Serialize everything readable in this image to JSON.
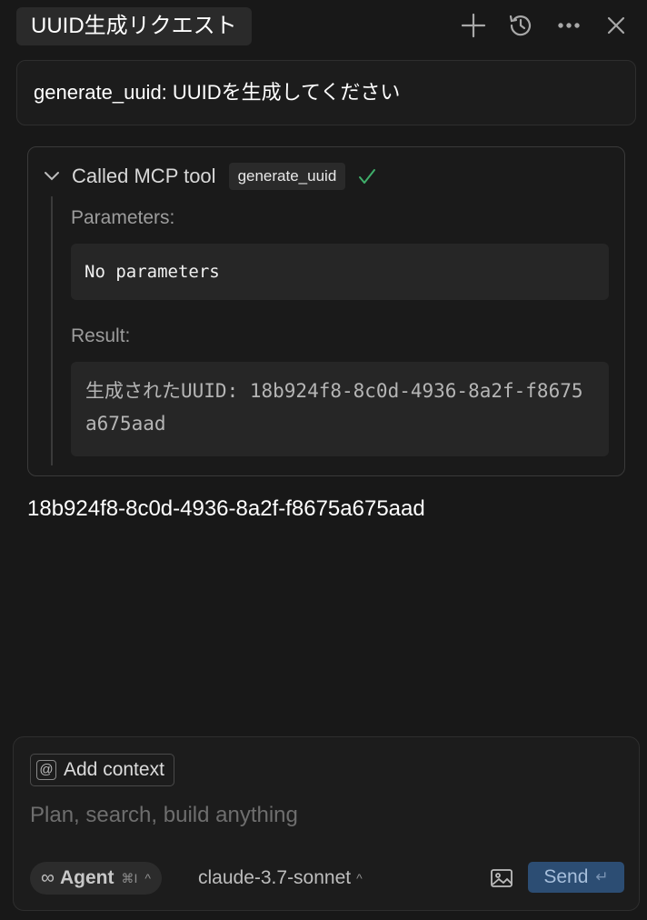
{
  "header": {
    "title": "UUID生成リクエスト",
    "icons": [
      "plus-icon",
      "history-icon",
      "more-icon",
      "close-icon"
    ]
  },
  "user_message": "generate_uuid: UUIDを生成してください",
  "tool_call": {
    "title": "Called MCP tool",
    "tool_name": "generate_uuid",
    "status": "success",
    "parameters_label": "Parameters:",
    "parameters_value": "No parameters",
    "result_label": "Result:",
    "result_value": "生成されたUUID: 18b924f8-8c0d-4936-8a2f-f8675a675aad"
  },
  "response": "18b924f8-8c0d-4936-8a2f-f8675a675aad",
  "composer": {
    "add_context_label": "Add context",
    "at_symbol": "@",
    "input_placeholder": "Plan, search, build anything",
    "agent_label": "Agent",
    "agent_shortcut": "⌘I",
    "model": "claude-3.7-sonnet",
    "send_label": "Send"
  },
  "colors": {
    "background": "#181818",
    "send_button": "#2c4d73",
    "success_check": "#3fae6a"
  }
}
